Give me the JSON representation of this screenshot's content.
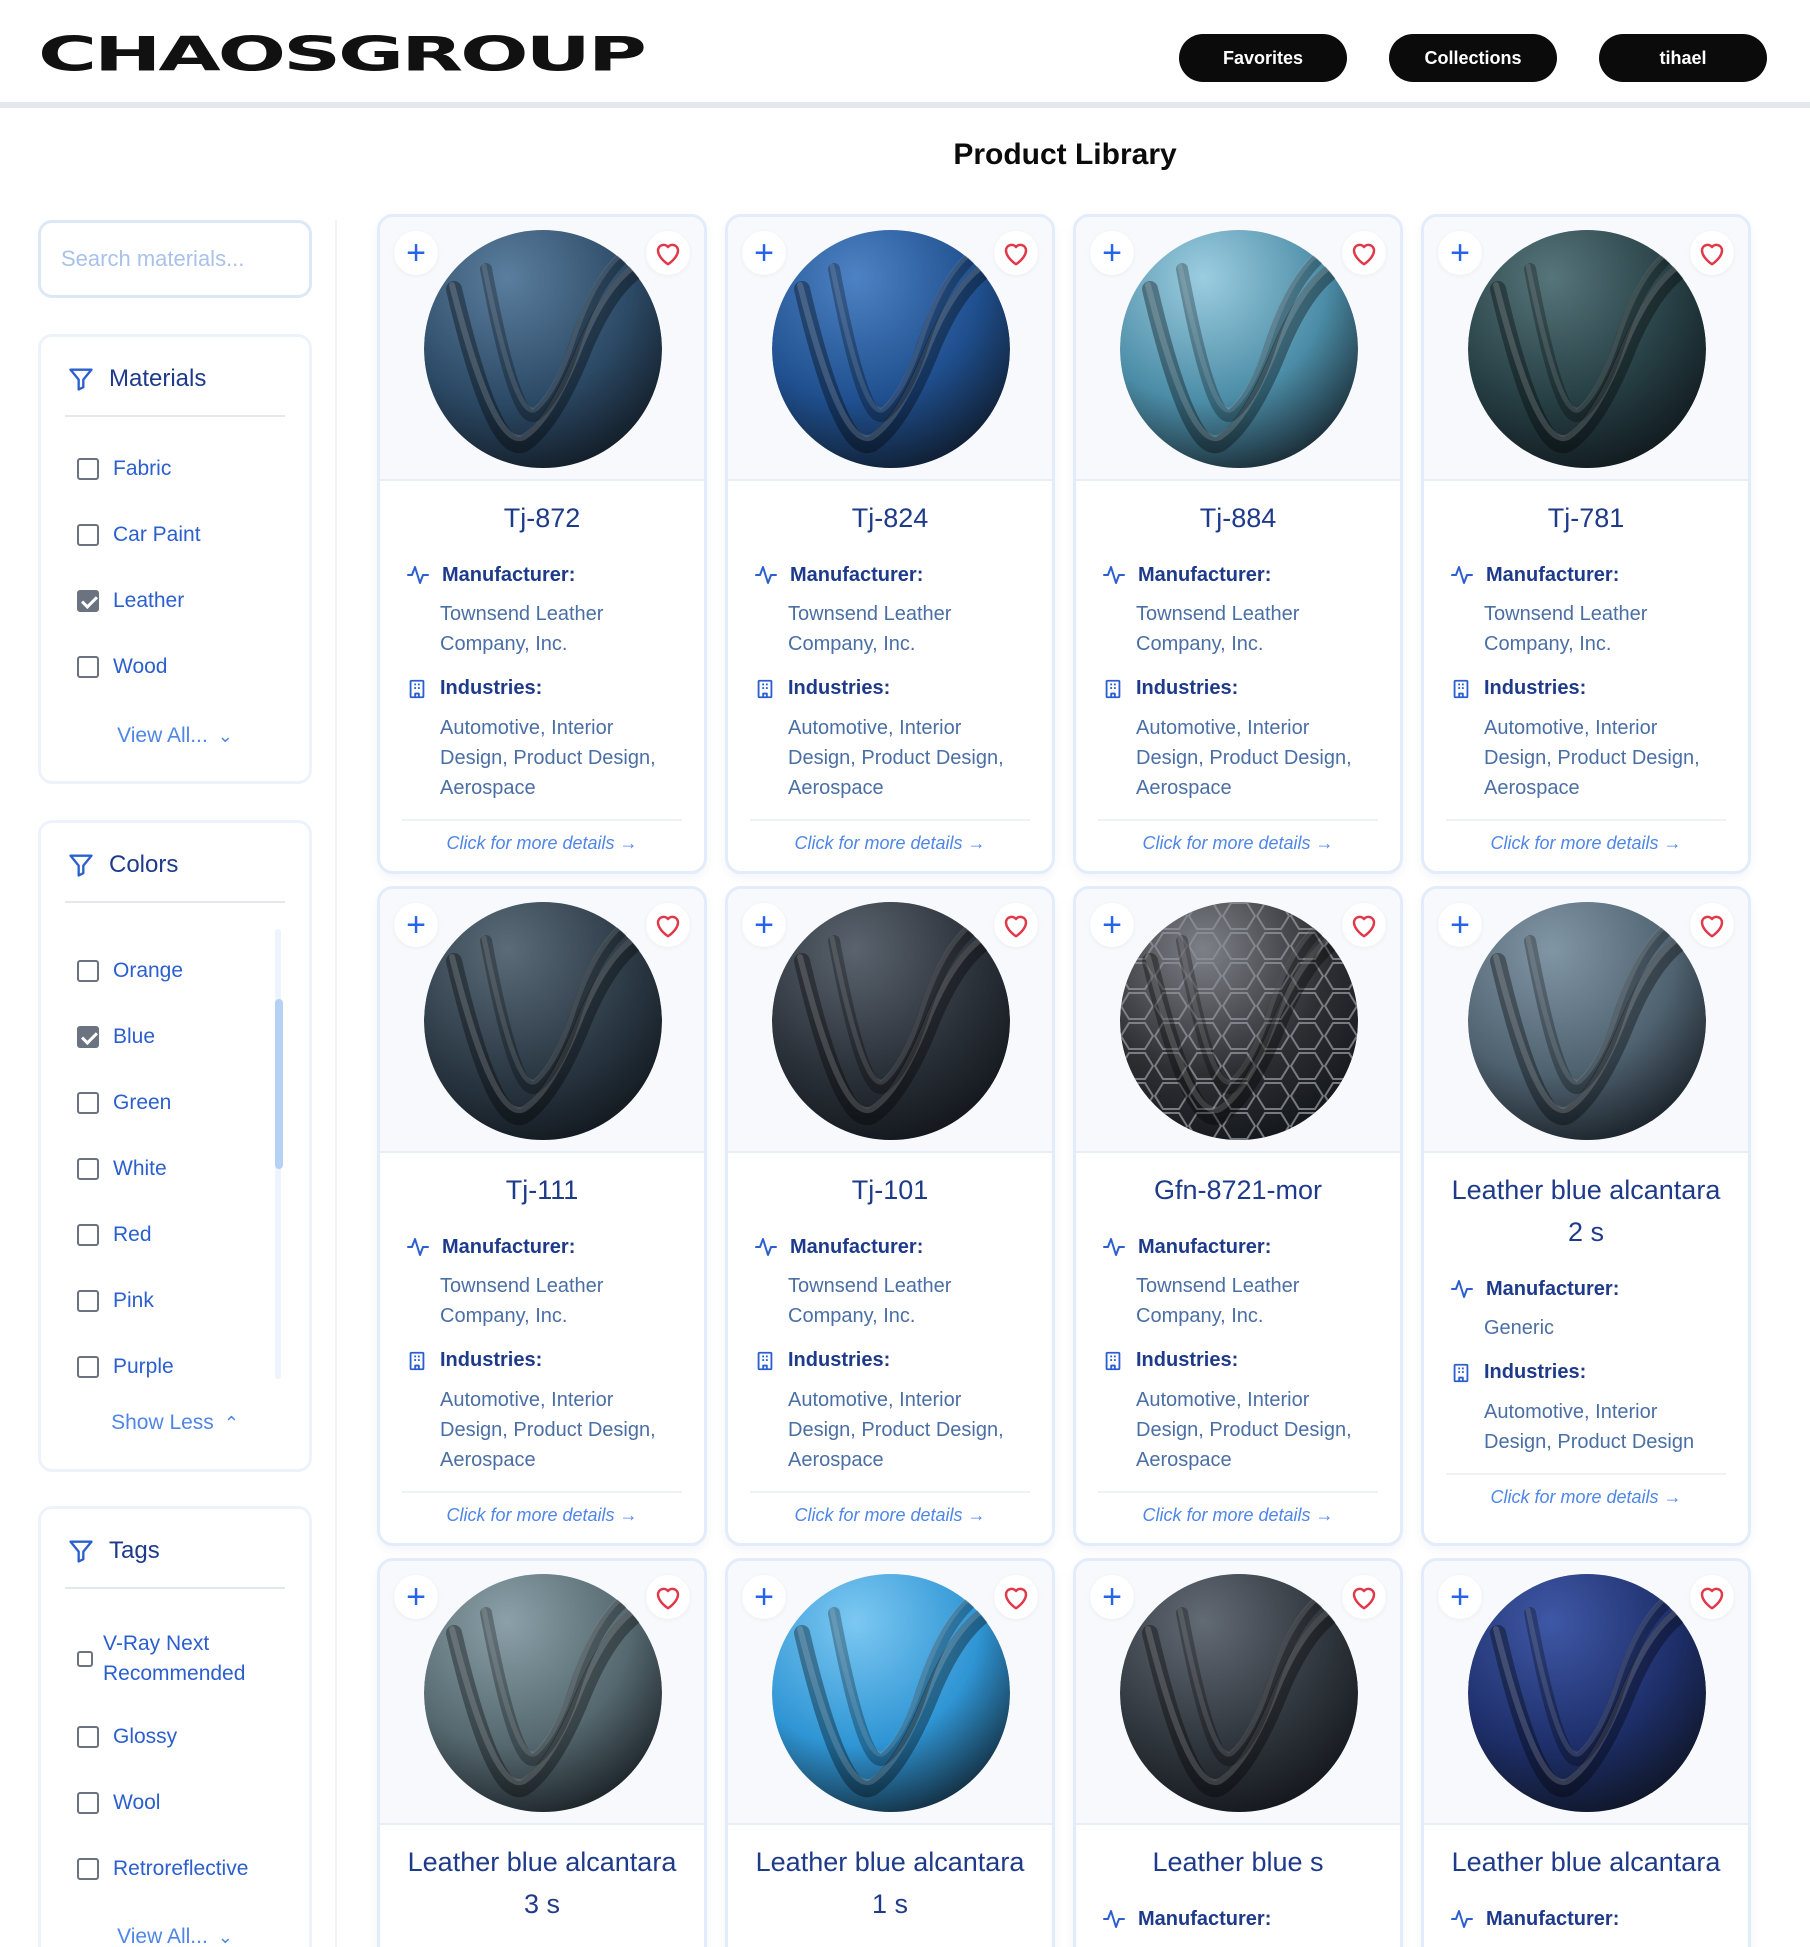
{
  "header": {
    "logo": "CHAOSGROUP",
    "favorites_label": "Favorites",
    "collections_label": "Collections",
    "user_label": "tihael"
  },
  "page_title": "Product Library",
  "search": {
    "placeholder": "Search materials...",
    "value": ""
  },
  "filters": {
    "materials": {
      "title": "Materials",
      "options": [
        {
          "label": "Fabric",
          "checked": false
        },
        {
          "label": "Car Paint",
          "checked": false
        },
        {
          "label": "Leather",
          "checked": true
        },
        {
          "label": "Wood",
          "checked": false
        }
      ],
      "toggle_label": "View All..."
    },
    "colors": {
      "title": "Colors",
      "options": [
        {
          "label": "Orange",
          "checked": false
        },
        {
          "label": "Blue",
          "checked": true
        },
        {
          "label": "Green",
          "checked": false
        },
        {
          "label": "White",
          "checked": false
        },
        {
          "label": "Red",
          "checked": false
        },
        {
          "label": "Pink",
          "checked": false
        },
        {
          "label": "Purple",
          "checked": false
        }
      ],
      "toggle_label": "Show Less"
    },
    "tags": {
      "title": "Tags",
      "options": [
        {
          "label": "V-Ray Next Recommended",
          "line1": "V-Ray Next",
          "line2": "Recommended",
          "checked": false
        },
        {
          "label": "Glossy",
          "checked": false
        },
        {
          "label": "Wool",
          "checked": false
        },
        {
          "label": "Retroreflective",
          "checked": false
        }
      ],
      "toggle_label": "View All..."
    }
  },
  "labels": {
    "manufacturer": "Manufacturer:",
    "industries": "Industries:",
    "more_details": "Click for more details →"
  },
  "products": [
    {
      "title": "Tj-872",
      "manufacturer_l1": "Townsend Leather",
      "manufacturer_l2": "Company, Inc.",
      "ind_l1": "Automotive, Interior",
      "ind_l2": "Design, Product Design,",
      "ind_l3": "Aerospace",
      "color": "#2c4a66",
      "highlight": "#5b7e9e",
      "pattern": "plain"
    },
    {
      "title": "Tj-824",
      "manufacturer_l1": "Townsend Leather",
      "manufacturer_l2": "Company, Inc.",
      "ind_l1": "Automotive, Interior",
      "ind_l2": "Design, Product Design,",
      "ind_l3": "Aerospace",
      "color": "#1f4f8e",
      "highlight": "#4d82c4",
      "pattern": "plain"
    },
    {
      "title": "Tj-884",
      "manufacturer_l1": "Townsend Leather",
      "manufacturer_l2": "Company, Inc.",
      "ind_l1": "Automotive, Interior",
      "ind_l2": "Design, Product Design,",
      "ind_l3": "Aerospace",
      "color": "#4b8ca6",
      "highlight": "#9ccde0",
      "pattern": "plain"
    },
    {
      "title": "Tj-781",
      "manufacturer_l1": "Townsend Leather",
      "manufacturer_l2": "Company, Inc.",
      "ind_l1": "Automotive, Interior",
      "ind_l2": "Design, Product Design,",
      "ind_l3": "Aerospace",
      "color": "#263f44",
      "highlight": "#56757a",
      "pattern": "plain"
    },
    {
      "title": "Tj-111",
      "manufacturer_l1": "Townsend Leather",
      "manufacturer_l2": "Company, Inc.",
      "ind_l1": "Automotive, Interior",
      "ind_l2": "Design, Product Design,",
      "ind_l3": "Aerospace",
      "color": "#2c3a46",
      "highlight": "#5b6b78",
      "pattern": "plain"
    },
    {
      "title": "Tj-101",
      "manufacturer_l1": "Townsend Leather",
      "manufacturer_l2": "Company, Inc.",
      "ind_l1": "Automotive, Interior",
      "ind_l2": "Design, Product Design,",
      "ind_l3": "Aerospace",
      "color": "#2b3139",
      "highlight": "#5a636e",
      "pattern": "plain"
    },
    {
      "title": "Gfn-8721-mor",
      "manufacturer_l1": "Townsend Leather",
      "manufacturer_l2": "Company, Inc.",
      "ind_l1": "Automotive, Interior",
      "ind_l2": "Design, Product Design,",
      "ind_l3": "Aerospace",
      "color": "#2e2f33",
      "highlight": "#7d8087",
      "pattern": "hex"
    },
    {
      "title": "Leather blue alcantara 2 s",
      "title_l1": "Leather blue alcantara",
      "title_l2": "2 s",
      "manufacturer_l1": "Generic",
      "manufacturer_l2": "",
      "ind_l1": "Automotive, Interior",
      "ind_l2": "Design, Product Design",
      "ind_l3": "",
      "color": "#4f6270",
      "highlight": "#8196a5",
      "pattern": "plain"
    },
    {
      "title": "Leather blue alcantara 3 s",
      "title_l1": "Leather blue alcantara",
      "title_l2": "3 s",
      "color": "#55686f",
      "highlight": "#8ba0a8",
      "pattern": "plain"
    },
    {
      "title": "Leather blue alcantara 1 s",
      "title_l1": "Leather blue alcantara",
      "title_l2": "1 s",
      "color": "#2f95d4",
      "highlight": "#7cc8f2",
      "pattern": "plain"
    },
    {
      "title": "Leather blue s",
      "title_l1": "Leather blue s",
      "title_l2": "",
      "color": "#30363d",
      "highlight": "#626a74",
      "pattern": "plain"
    },
    {
      "title": "Leather blue alcantara",
      "title_l1": "Leather blue alcantara",
      "title_l2": "",
      "color": "#1e2f6b",
      "highlight": "#3f58a6",
      "pattern": "plain"
    }
  ]
}
